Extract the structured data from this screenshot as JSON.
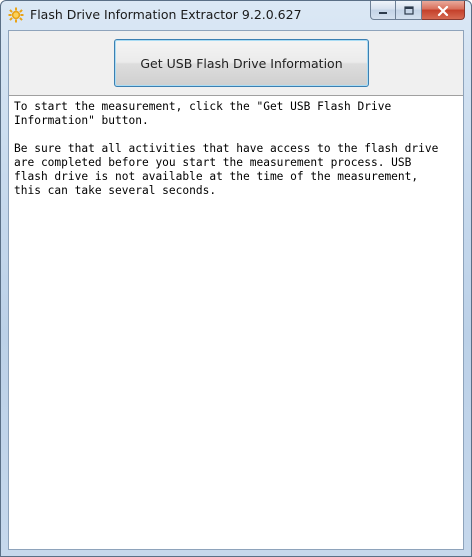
{
  "window": {
    "title": "Flash Drive Information Extractor 9.2.0.627",
    "app_icon": "sun-gear-icon"
  },
  "caption_buttons": {
    "minimize_icon": "minimize-icon",
    "maximize_icon": "maximize-icon",
    "close_icon": "close-icon"
  },
  "toolbar": {
    "get_info_label": "Get USB Flash Drive Information"
  },
  "output": {
    "paragraph1": "To start the measurement, click the \"Get USB Flash Drive\nInformation\" button.",
    "paragraph2": "Be sure that all activities that have access to the flash drive\nare completed before you start the measurement process. USB\nflash drive is not available at the time of the measurement,\nthis can take several seconds."
  },
  "colors": {
    "focus_border": "#3c7fb1",
    "close_button": "#c4402a"
  }
}
